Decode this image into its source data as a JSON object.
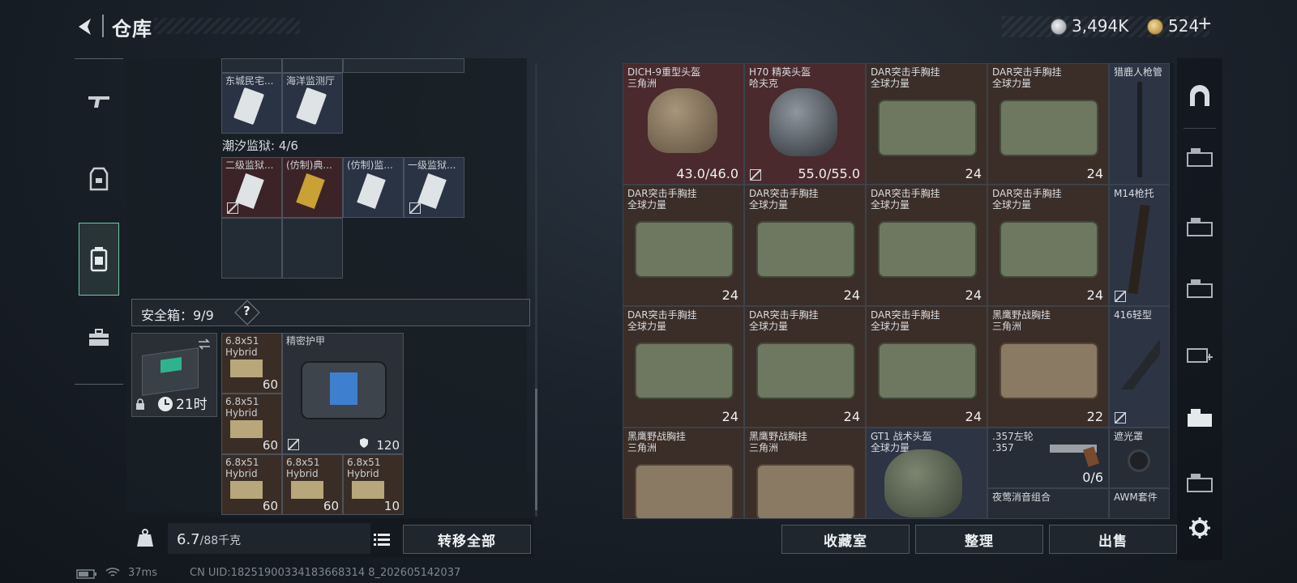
{
  "header": {
    "title": "仓库",
    "silver_amount": "3,494K",
    "gold_amount": "524",
    "add_label": "+"
  },
  "left": {
    "row1_items": [
      {
        "name": "东城民宅...",
        "rarity": "blue"
      },
      {
        "name": "海洋监测厅",
        "rarity": "blue"
      }
    ],
    "prison_label": "潮汐监狱: 4/6",
    "prison_items": [
      {
        "name": "二级监狱...",
        "rarity": "red"
      },
      {
        "name": "(仿制)典...",
        "rarity": "red"
      },
      {
        "name": "(仿制)监...",
        "rarity": "blue"
      },
      {
        "name": "一级监狱...",
        "rarity": "blue"
      }
    ],
    "safebox_label": "安全箱：9/9",
    "help_label": "?",
    "safebox_timer": "21时",
    "armor_name": "精密护甲",
    "armor_durability": "120",
    "ammo": [
      {
        "name": "6.8x51",
        "sub": "Hybrid",
        "count": "60"
      },
      {
        "name": "6.8x51",
        "sub": "Hybrid",
        "count": "60"
      },
      {
        "name": "6.8x51",
        "sub": "Hybrid",
        "count": "60"
      },
      {
        "name": "6.8x51",
        "sub": "Hybrid",
        "count": "60"
      },
      {
        "name": "6.8x51",
        "sub": "Hybrid",
        "count": "10"
      }
    ],
    "weight_value": "6.7",
    "weight_max": "/88千克",
    "transfer_all": "转移全部"
  },
  "grid": [
    {
      "name": "DICH-9重型头盔",
      "sub": "三角洲",
      "count": "43.0/46.0",
      "bg": "red"
    },
    {
      "name": "H70 精英头盔",
      "sub": "哈夫克",
      "count": "55.0/55.0",
      "bg": "red"
    },
    {
      "name": "DAR突击手胸挂",
      "sub": "全球力量",
      "count": "24",
      "bg": "brown"
    },
    {
      "name": "DAR突击手胸挂",
      "sub": "全球力量",
      "count": "24",
      "bg": "brown"
    },
    {
      "name": "DAR突击手胸挂",
      "sub": "全球力量",
      "count": "24",
      "bg": "brown"
    },
    {
      "name": "DAR突击手胸挂",
      "sub": "全球力量",
      "count": "24",
      "bg": "brown"
    },
    {
      "name": "DAR突击手胸挂",
      "sub": "全球力量",
      "count": "24",
      "bg": "brown"
    },
    {
      "name": "DAR突击手胸挂",
      "sub": "全球力量",
      "count": "24",
      "bg": "brown"
    },
    {
      "name": "DAR突击手胸挂",
      "sub": "全球力量",
      "count": "24",
      "bg": "brown"
    },
    {
      "name": "DAR突击手胸挂",
      "sub": "全球力量",
      "count": "24",
      "bg": "brown"
    },
    {
      "name": "DAR突击手胸挂",
      "sub": "全球力量",
      "count": "24",
      "bg": "brown"
    },
    {
      "name": "黑鹰野战胸挂",
      "sub": "三角洲",
      "count": "22",
      "bg": "brown"
    },
    {
      "name": "黑鹰野战胸挂",
      "sub": "三角洲",
      "count": "",
      "bg": "brown"
    },
    {
      "name": "黑鹰野战胸挂",
      "sub": "三角洲",
      "count": "",
      "bg": "brown"
    },
    {
      "name": "GT1 战术头盔",
      "sub": "全球力量",
      "count": "",
      "bg": "blue"
    }
  ],
  "side_items": [
    {
      "name": "猎鹿人枪管"
    },
    {
      "name": "M14枪托"
    },
    {
      "name": "416轻型"
    },
    {
      "name": "遮光罩"
    },
    {
      "name": "AWM套件"
    }
  ],
  "revolver": {
    "name": ".357左轮",
    "sub": ".357",
    "count": "0/6"
  },
  "night_combo": {
    "name": "夜莺消音组合"
  },
  "buttons": {
    "collection": "收藏室",
    "sort": "整理",
    "sell": "出售"
  },
  "status": {
    "ping": "37ms",
    "uid": "CN UID:18251900334183668314 8_202605142037"
  }
}
